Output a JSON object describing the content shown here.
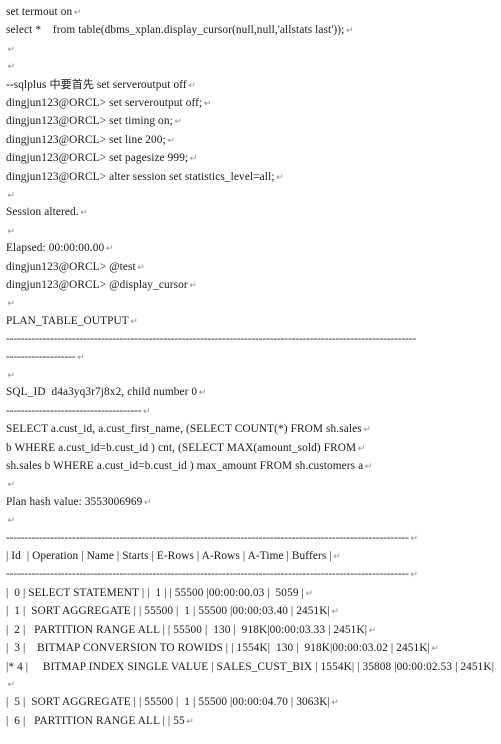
{
  "document": {
    "kind": "sqlplus-session-transcript",
    "background_color": "#ffffff",
    "text_color": "#1a1a1a",
    "paragraph_mark": "↵",
    "paragraph_mark_color": "#8c8c8c"
  },
  "lines": [
    {
      "id": "l01",
      "text": "set termout on",
      "mark": "↵"
    },
    {
      "id": "l02",
      "text": "select *    from table(dbms_xplan.display_cursor(null,null,'allstats last'));",
      "mark": "↵"
    },
    {
      "id": "l03",
      "text": "",
      "mark": "↵"
    },
    {
      "id": "l04",
      "text": "",
      "mark": "↵"
    },
    {
      "id": "l05a",
      "text": "--sqlplus ",
      "cjk": "中要首先",
      "text_after": " set serveroutput off",
      "mark": "↵"
    },
    {
      "id": "l06",
      "text": "dingjun123@ORCL&gt; set serveroutput off;",
      "mark": "↵"
    },
    {
      "id": "l07",
      "text": "dingjun123@ORCL&gt; set timing on;",
      "mark": "↵"
    },
    {
      "id": "l08",
      "text": "dingjun123@ORCL&gt; set line 200;",
      "mark": "↵"
    },
    {
      "id": "l09",
      "text": "dingjun123@ORCL&gt; set pagesize 999;",
      "mark": "↵"
    },
    {
      "id": "l10",
      "text": "dingjun123@ORCL&gt; alter session set statistics_level=all;",
      "mark": "↵"
    },
    {
      "id": "l11",
      "text": "",
      "mark": "↵"
    },
    {
      "id": "l12",
      "text": "Session altered.",
      "mark": "↵"
    },
    {
      "id": "l13",
      "text": "",
      "mark": "↵"
    },
    {
      "id": "l14",
      "text": "Elapsed: 00:00:00.00",
      "mark": "↵"
    },
    {
      "id": "l15",
      "text": "dingjun123@ORCL&gt; @test",
      "mark": "↵"
    },
    {
      "id": "l16",
      "text": "dingjun123@ORCL&gt; @display_cursor",
      "mark": "↵"
    },
    {
      "id": "l17",
      "text": "",
      "mark": "↵"
    },
    {
      "id": "l18",
      "text": "PLAN_TABLE_OUTPUT",
      "mark": "↵"
    },
    {
      "id": "l19",
      "rule_long": true,
      "rule_tail": "-------------------",
      "mark": "↵"
    },
    {
      "id": "l20",
      "text": "",
      "mark": "↵"
    },
    {
      "id": "l21",
      "text": "SQL_ID  d4a3yq3r7j8x2, child number 0",
      "mark": "↵"
    },
    {
      "id": "l22",
      "rule_short": "-------------------------------------",
      "mark": "↵"
    },
    {
      "id": "l23",
      "text": "SELECT a.cust_id, a.cust_first_name, (SELECT COUNT(*) FROM sh.sales",
      "mark": "↵"
    },
    {
      "id": "l24",
      "text": "b WHERE a.cust_id=b.cust_id ) cnt, (SELECT MAX(amount_sold) FROM",
      "mark": "↵"
    },
    {
      "id": "l25",
      "text": "sh.sales b WHERE a.cust_id=b.cust_id ) max_amount FROM sh.customers a",
      "mark": "↵"
    },
    {
      "id": "l26",
      "text": "",
      "mark": "↵"
    },
    {
      "id": "l27",
      "text": "Plan hash value: 3553006969",
      "mark": "↵"
    },
    {
      "id": "l28",
      "text": "",
      "mark": "↵"
    },
    {
      "id": "l29",
      "rule_full": true,
      "mark": "↵"
    },
    {
      "id": "l30",
      "text": "| Id  | Operation | Name | Starts | E-Rows | A-Rows | A-Time | Buffers |",
      "mark": "↵"
    },
    {
      "id": "l31",
      "rule_full": true,
      "mark": "↵"
    },
    {
      "id": "l32",
      "text": "|  0 | SELECT STATEMENT | |  1 | | 55500 |00:00:00.03 |  5059 |",
      "mark": "↵"
    },
    {
      "id": "l33",
      "text": "|  1 |  SORT AGGREGATE | | 55500 |  1 | 55500 |00:00:03.40 | 2451K|",
      "mark": "↵"
    },
    {
      "id": "l34",
      "text": "|  2 |   PARTITION RANGE ALL | | 55500 |  130 |  918K|00:00:03.33 | 2451K|",
      "mark": "↵"
    },
    {
      "id": "l35",
      "text": "|  3 |    BITMAP CONVERSION TO ROWIDS | | 1554K|  130 |  918K|00:00:03.02 | 2451K|",
      "mark": "↵"
    },
    {
      "id": "l36",
      "text": "|* 4 |     BITMAP INDEX SINGLE VALUE | SALES_CUST_BIX | 1554K| | 35808 |00:00:02.53 | 2451K|",
      "mark": "↵"
    },
    {
      "id": "l37",
      "text": "|  5 |  SORT AGGREGATE | | 55500 |  1 | 55500 |00:00:04.70 | 3063K|",
      "mark": "↵"
    },
    {
      "id": "l38",
      "text": "|  6 |   PARTITION RANGE ALL | | 55",
      "mark": "↵"
    }
  ],
  "plan_table": {
    "columns": [
      "Id",
      "Operation",
      "Name",
      "Starts",
      "E-Rows",
      "A-Rows",
      "A-Time",
      "Buffers"
    ],
    "rows": [
      {
        "id": "0",
        "operation": "SELECT STATEMENT",
        "name": "",
        "starts": "1",
        "e_rows": "",
        "a_rows": "55500",
        "a_time": "00:00:00.03",
        "buffers": "5059"
      },
      {
        "id": "1",
        "operation": "SORT AGGREGATE",
        "name": "",
        "starts": "55500",
        "e_rows": "1",
        "a_rows": "55500",
        "a_time": "00:00:03.40",
        "buffers": "2451K"
      },
      {
        "id": "2",
        "operation": "PARTITION RANGE ALL",
        "name": "",
        "starts": "55500",
        "e_rows": "130",
        "a_rows": "918K",
        "a_time": "00:00:03.33",
        "buffers": "2451K"
      },
      {
        "id": "3",
        "operation": "BITMAP CONVERSION TO ROWIDS",
        "name": "",
        "starts": "1554K",
        "e_rows": "130",
        "a_rows": "918K",
        "a_time": "00:00:03.02",
        "buffers": "2451K"
      },
      {
        "id": "* 4",
        "operation": "BITMAP INDEX SINGLE VALUE",
        "name": "SALES_CUST_BIX",
        "starts": "1554K",
        "e_rows": "",
        "a_rows": "35808",
        "a_time": "00:00:02.53",
        "buffers": "2451K"
      },
      {
        "id": "5",
        "operation": "SORT AGGREGATE",
        "name": "",
        "starts": "55500",
        "e_rows": "1",
        "a_rows": "55500",
        "a_time": "00:00:04.70",
        "buffers": "3063K"
      },
      {
        "id": "6",
        "operation": "PARTITION RANGE ALL",
        "name": "",
        "starts": "55",
        "e_rows": "",
        "a_rows": "",
        "a_time": "",
        "buffers": ""
      }
    ]
  },
  "session": {
    "prompt": "dingjun123@ORCL&gt;",
    "sql_id": "d4a3yq3r7j8x2",
    "child_number": "0",
    "plan_hash_value": "3553006969",
    "elapsed": "00:00:00.00",
    "status_message": "Session altered.",
    "plan_table_output_header": "PLAN_TABLE_OUTPUT"
  }
}
